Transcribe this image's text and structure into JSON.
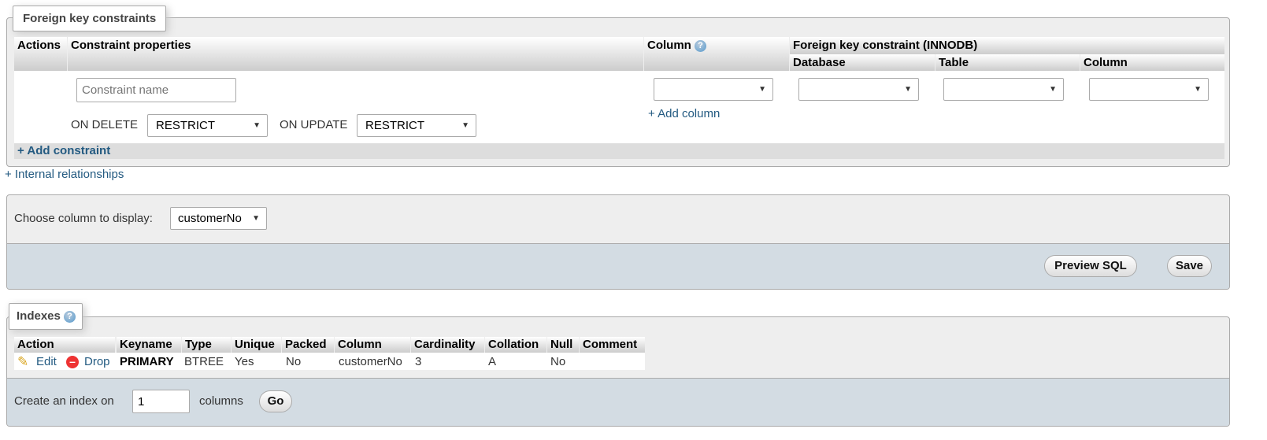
{
  "fk": {
    "legend": "Foreign key constraints",
    "headers": {
      "actions": "Actions",
      "props": "Constraint properties",
      "column": "Column",
      "fk_group": "Foreign key constraint (INNODB)",
      "database": "Database",
      "table": "Table",
      "fk_column": "Column"
    },
    "constraint_name_placeholder": "Constraint name",
    "on_delete_label": "ON DELETE",
    "on_delete": "RESTRICT",
    "on_update_label": "ON UPDATE",
    "on_update": "RESTRICT",
    "add_column": "+ Add column",
    "add_constraint": "+ Add constraint"
  },
  "internal_relationships": "+ Internal relationships",
  "display": {
    "label": "Choose column to display:",
    "value": "customerNo",
    "preview_sql": "Preview SQL",
    "save": "Save"
  },
  "indexes": {
    "legend": "Indexes",
    "headers": [
      "Action",
      "Keyname",
      "Type",
      "Unique",
      "Packed",
      "Column",
      "Cardinality",
      "Collation",
      "Null",
      "Comment"
    ],
    "row": {
      "edit": "Edit",
      "drop": "Drop",
      "keyname": "PRIMARY",
      "type": "BTREE",
      "unique": "Yes",
      "packed": "No",
      "column": "customerNo",
      "cardinality": "3",
      "collation": "A",
      "null": "No",
      "comment": ""
    },
    "create_label": "Create an index on",
    "create_value": "1",
    "columns_label": "columns",
    "go": "Go"
  }
}
